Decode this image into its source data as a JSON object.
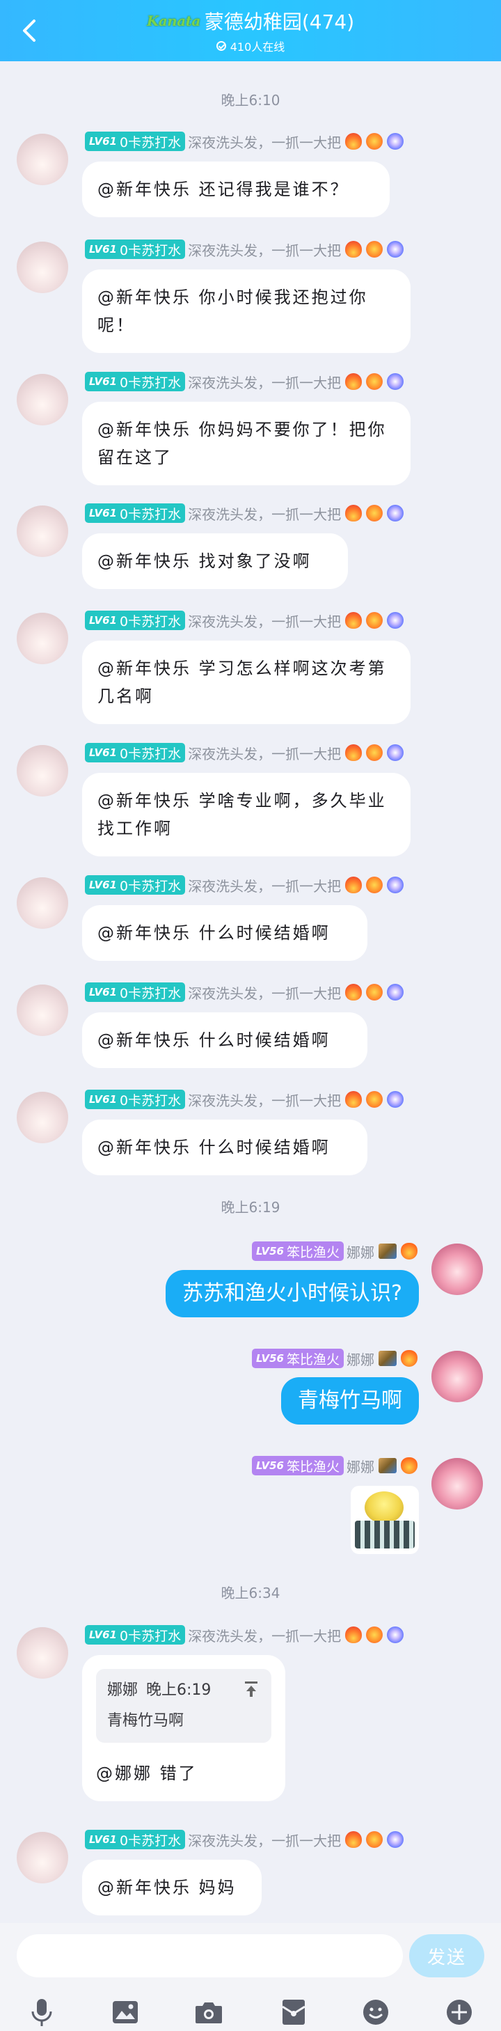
{
  "header": {
    "logo_text": "Kanata",
    "title": "蒙德幼稚园(474)",
    "online": "410人在线"
  },
  "time_labels": [
    "晚上6:10",
    "晚上6:19",
    "晚上6:34"
  ],
  "users": {
    "left_level": "LV61",
    "left_title": "0卡苏打水",
    "left_status": "深夜洗头发，一抓一大把",
    "right_level": "LV56",
    "right_title": "笨比渔火",
    "right_name": "娜娜"
  },
  "messages": {
    "m1": "@新年快乐 还记得我是谁不？",
    "m2": "@新年快乐 你小时候我还抱过你呢！",
    "m3": "@新年快乐 你妈妈不要你了！把你留在这了",
    "m4": "@新年快乐 找对象了没啊",
    "m5": "@新年快乐 学习怎么样啊这次考第几名啊",
    "m6": "@新年快乐 学啥专业啊，多久毕业找工作啊",
    "m7": "@新年快乐 什么时候结婚啊",
    "m8": "@新年快乐 什么时候结婚啊",
    "m9": "@新年快乐 什么时候结婚啊",
    "r1": "苏苏和渔火小时候认识?",
    "r2": "青梅竹马啊",
    "quote_author": "娜娜",
    "quote_time": "晚上6:19",
    "quote_text": "青梅竹马啊",
    "m10": "@娜娜 错了",
    "m11": "@新年快乐 妈妈"
  },
  "input": {
    "placeholder": "",
    "send_label": "发送"
  },
  "colors": {
    "header": "#29c6ff",
    "bubble_right": "#1aadf6",
    "level_teal": "#23c6c4",
    "level_purple": "#b384f1",
    "send_disabled": "#b8e6fc"
  }
}
